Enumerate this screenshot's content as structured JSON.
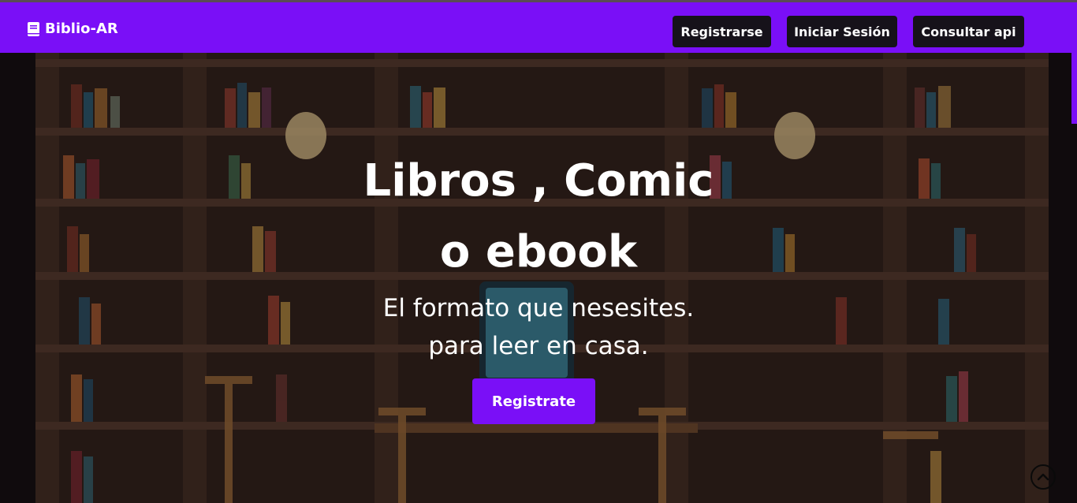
{
  "navbar": {
    "brand": "Biblio-AR",
    "brand_icon": "book-icon",
    "accent": "#7a0ff7",
    "buttons": {
      "register": "Registrarse",
      "login": "Iniciar Sesión",
      "api": "Consultar api"
    }
  },
  "hero": {
    "title_line1": "Libros , Comic",
    "title_line2": "o ebook",
    "subtitle_line1": "El formato que nesesites.",
    "subtitle_line2": "para leer en casa.",
    "cta": "Registrate",
    "background": "bookshelf-illustration"
  },
  "scroll_top_icon": "chevron-up-circle-icon"
}
